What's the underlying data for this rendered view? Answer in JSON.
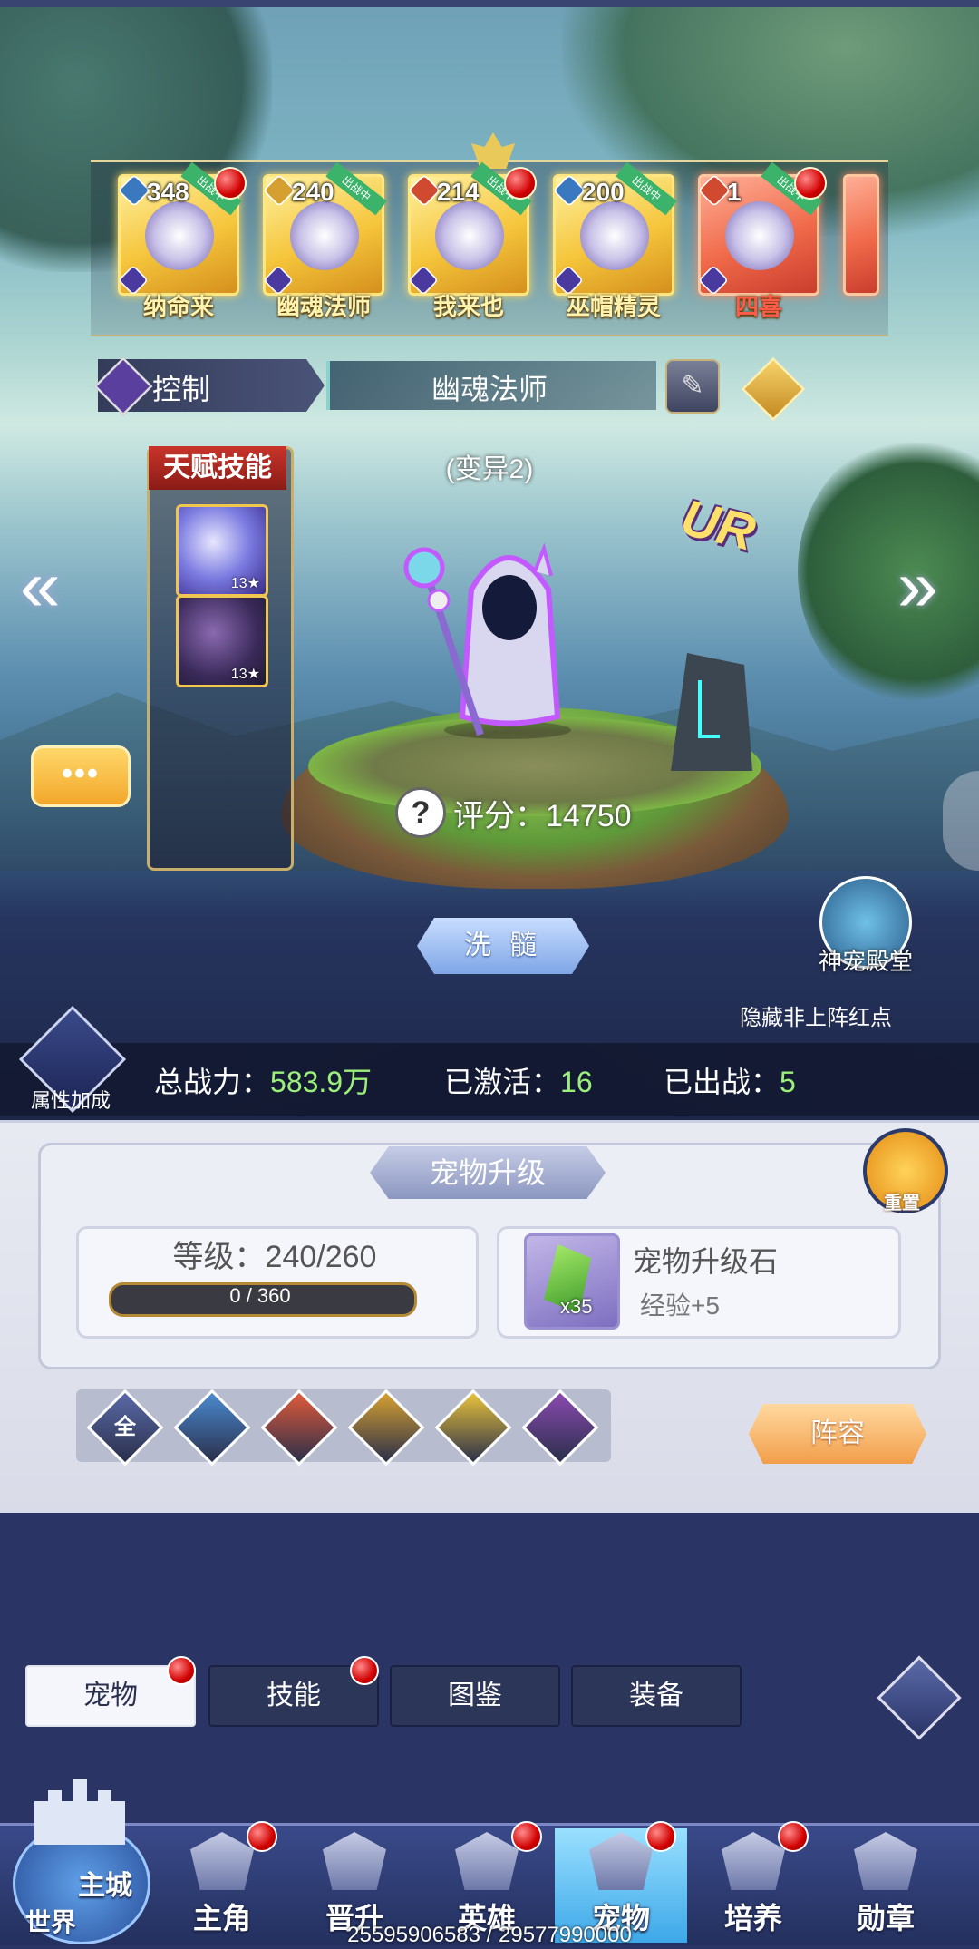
{
  "pet_strip": [
    {
      "num": "348",
      "name": "纳命来",
      "style": "gold",
      "ribbon": "出战中",
      "dot": true,
      "elem": "#3a78c0"
    },
    {
      "num": "240",
      "name": "幽魂法师",
      "style": "gold",
      "ribbon": "出战中",
      "dot": false,
      "elem": "#d6a030"
    },
    {
      "num": "214",
      "name": "我来也",
      "style": "gold",
      "ribbon": "出战中",
      "dot": true,
      "elem": "#d04a30"
    },
    {
      "num": "200",
      "name": "巫帽精灵",
      "style": "gold",
      "ribbon": "出战中",
      "dot": false,
      "elem": "#3a78c0"
    },
    {
      "num": "1",
      "name": "四喜",
      "style": "red",
      "ribbon": "出战中",
      "dot": true,
      "elem": "#d04a30"
    }
  ],
  "pet_class": "控制",
  "pet_name": "幽魂法师",
  "variant": "(变异2)",
  "rarity": "UR",
  "talent": {
    "title": "天赋技能",
    "skills": [
      {
        "level": "13★"
      },
      {
        "level": "13★"
      }
    ]
  },
  "score": {
    "label": "评分：14750"
  },
  "wash_label": "洗 髓",
  "hall_label": "神宠殿堂",
  "hide_dot_label": "隐藏非上阵红点",
  "stats": {
    "attr_label": "属性加成",
    "power_label": "总战力：",
    "power_value": "583.9万",
    "active_label": "已激活：",
    "active_value": "16",
    "deployed_label": "已出战：",
    "deployed_value": "5"
  },
  "upgrade": {
    "title": "宠物升级",
    "reset_label": "重置",
    "level_text": "等级：240/260",
    "exp_text": "0 / 360",
    "exp_progress": 0,
    "stone_name": "宠物升级石",
    "stone_count": "x35",
    "stone_exp": "经验+5"
  },
  "filters": [
    {
      "icon": "all-filter-icon",
      "label": "全",
      "color": "#5a6aa8"
    },
    {
      "icon": "water-filter-icon",
      "label": "",
      "color": "#4a8ad0"
    },
    {
      "icon": "fire-filter-icon",
      "label": "",
      "color": "#e05a3a"
    },
    {
      "icon": "earth-filter-icon",
      "label": "",
      "color": "#d6a030"
    },
    {
      "icon": "light-filter-icon",
      "label": "",
      "color": "#e8c23a"
    },
    {
      "icon": "dark-filter-icon",
      "label": "",
      "color": "#8a4ab0"
    }
  ],
  "team_label": "阵容",
  "subtabs": [
    {
      "label": "宠物",
      "active": true,
      "dot": true
    },
    {
      "label": "技能",
      "active": false,
      "dot": true
    },
    {
      "label": "图鉴",
      "active": false,
      "dot": false
    },
    {
      "label": "装备",
      "active": false,
      "dot": false
    }
  ],
  "nav": {
    "main_city": "主城",
    "world": "世界",
    "items": [
      {
        "label": "主角",
        "dot": true,
        "active": false
      },
      {
        "label": "晋升",
        "dot": false,
        "active": false
      },
      {
        "label": "英雄",
        "dot": true,
        "active": false
      },
      {
        "label": "宠物",
        "dot": true,
        "active": true
      },
      {
        "label": "培养",
        "dot": true,
        "active": false
      },
      {
        "label": "勋章",
        "dot": false,
        "active": false
      }
    ]
  },
  "footer": "25595906583 / 29577990000"
}
